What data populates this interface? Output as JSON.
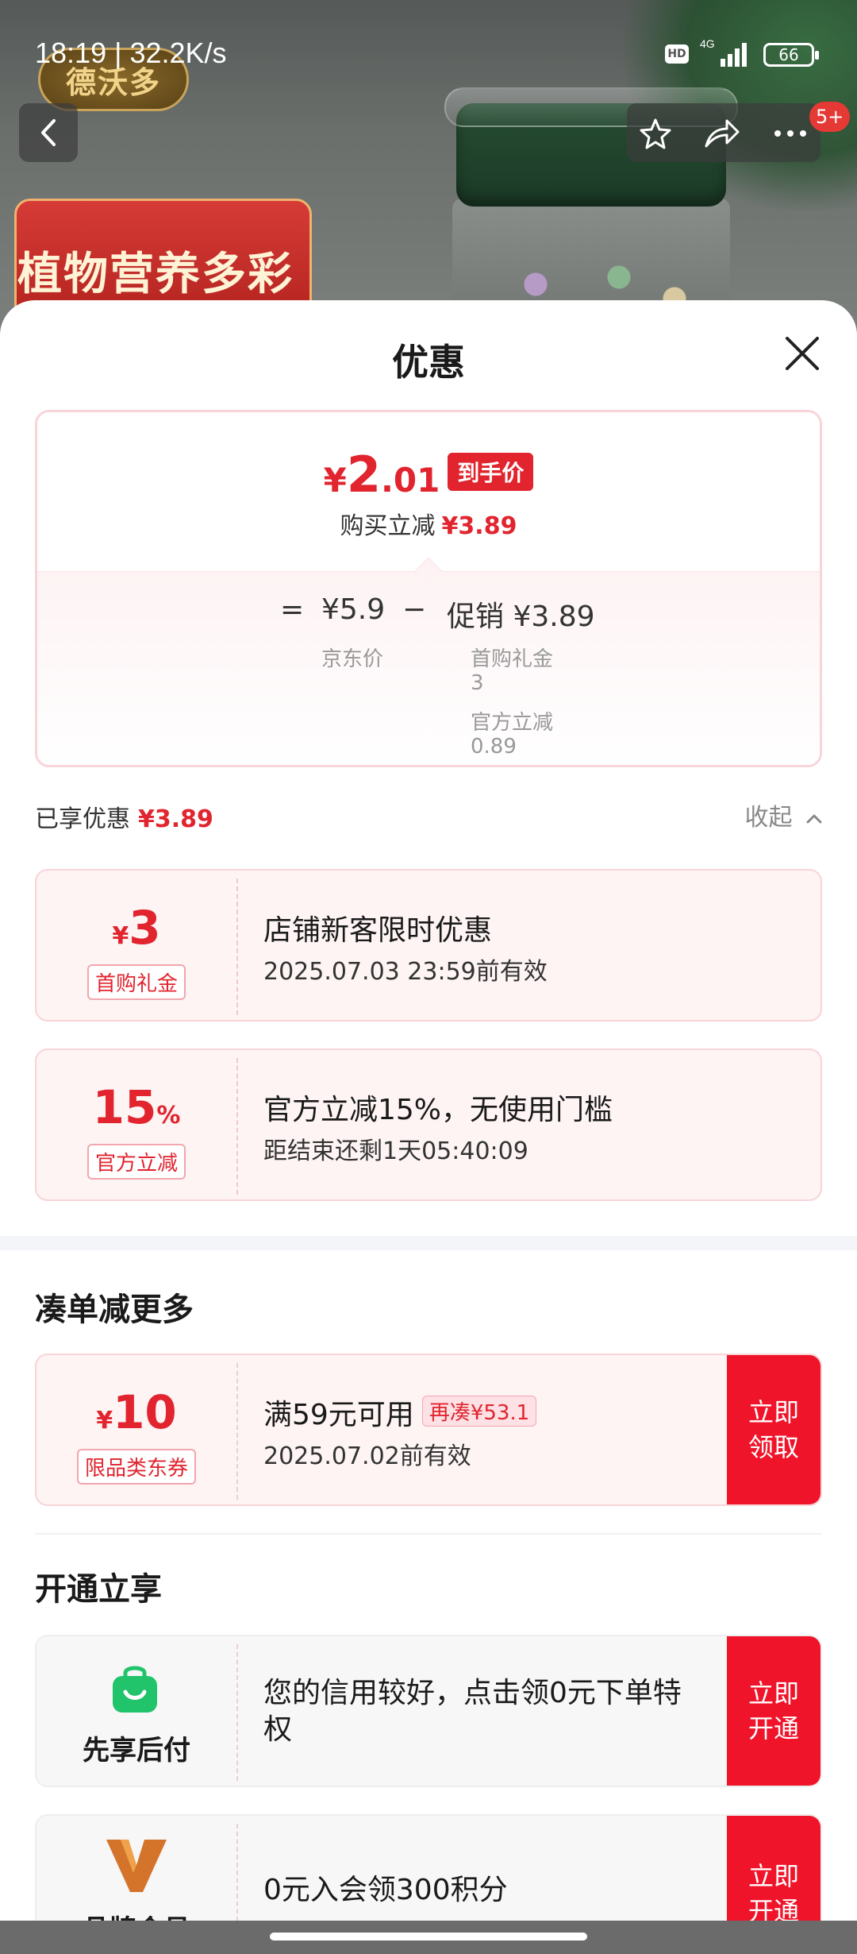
{
  "status_bar": {
    "time": "18:19 | 32.2K/s",
    "hd": "HD",
    "network": "4G",
    "battery": "66"
  },
  "background": {
    "logo": "德沃多",
    "banner": "植物营养多彩"
  },
  "nav": {
    "badge": "5+"
  },
  "sheet": {
    "title": "优惠"
  },
  "price": {
    "yen": "¥",
    "int": "2",
    "dec": ".01",
    "tag": "到手价",
    "sub_label": "购买立减",
    "sub_value": "¥3.89",
    "eq": "=",
    "jd_price": "¥5.9",
    "jd_label": "京东价",
    "minus": "−",
    "promo": "促销 ¥3.89",
    "promo_item1_label": "首购礼金",
    "promo_item1_value": "3",
    "promo_item2_label": "官方立减",
    "promo_item2_value": "0.89"
  },
  "enjoyed": {
    "label": "已享优惠",
    "value": "¥3.89",
    "collapse": "收起"
  },
  "coupons": [
    {
      "sym": "¥",
      "num": "3",
      "label": "首购礼金",
      "title": "店铺新客限时优惠",
      "sub": "2025.07.03 23:59前有效"
    },
    {
      "num": "15",
      "sym": "%",
      "label": "官方立减",
      "title": "官方立减15%，无使用门槛",
      "sub": "距结束还剩1天05:40:09"
    }
  ],
  "more_section": {
    "title": "凑单减更多",
    "card": {
      "sym": "¥",
      "num": "10",
      "label": "限品类东券",
      "title": "满59元可用",
      "tag": "再凑¥53.1",
      "sub": "2025.07.02前有效",
      "action_l1": "立即",
      "action_l2": "领取"
    }
  },
  "open_section": {
    "title": "开通立享",
    "cards": [
      {
        "name": "先享后付",
        "title_l1": "您的信用较好，点击领0元下单特",
        "title_l2": "权",
        "action_l1": "立即",
        "action_l2": "开通"
      },
      {
        "name": "品牌会员",
        "title": "0元入会领300积分",
        "action_l1": "立即",
        "action_l2": "开通"
      }
    ]
  },
  "colors": {
    "accent": "#e1242e",
    "action": "#f0142b"
  }
}
